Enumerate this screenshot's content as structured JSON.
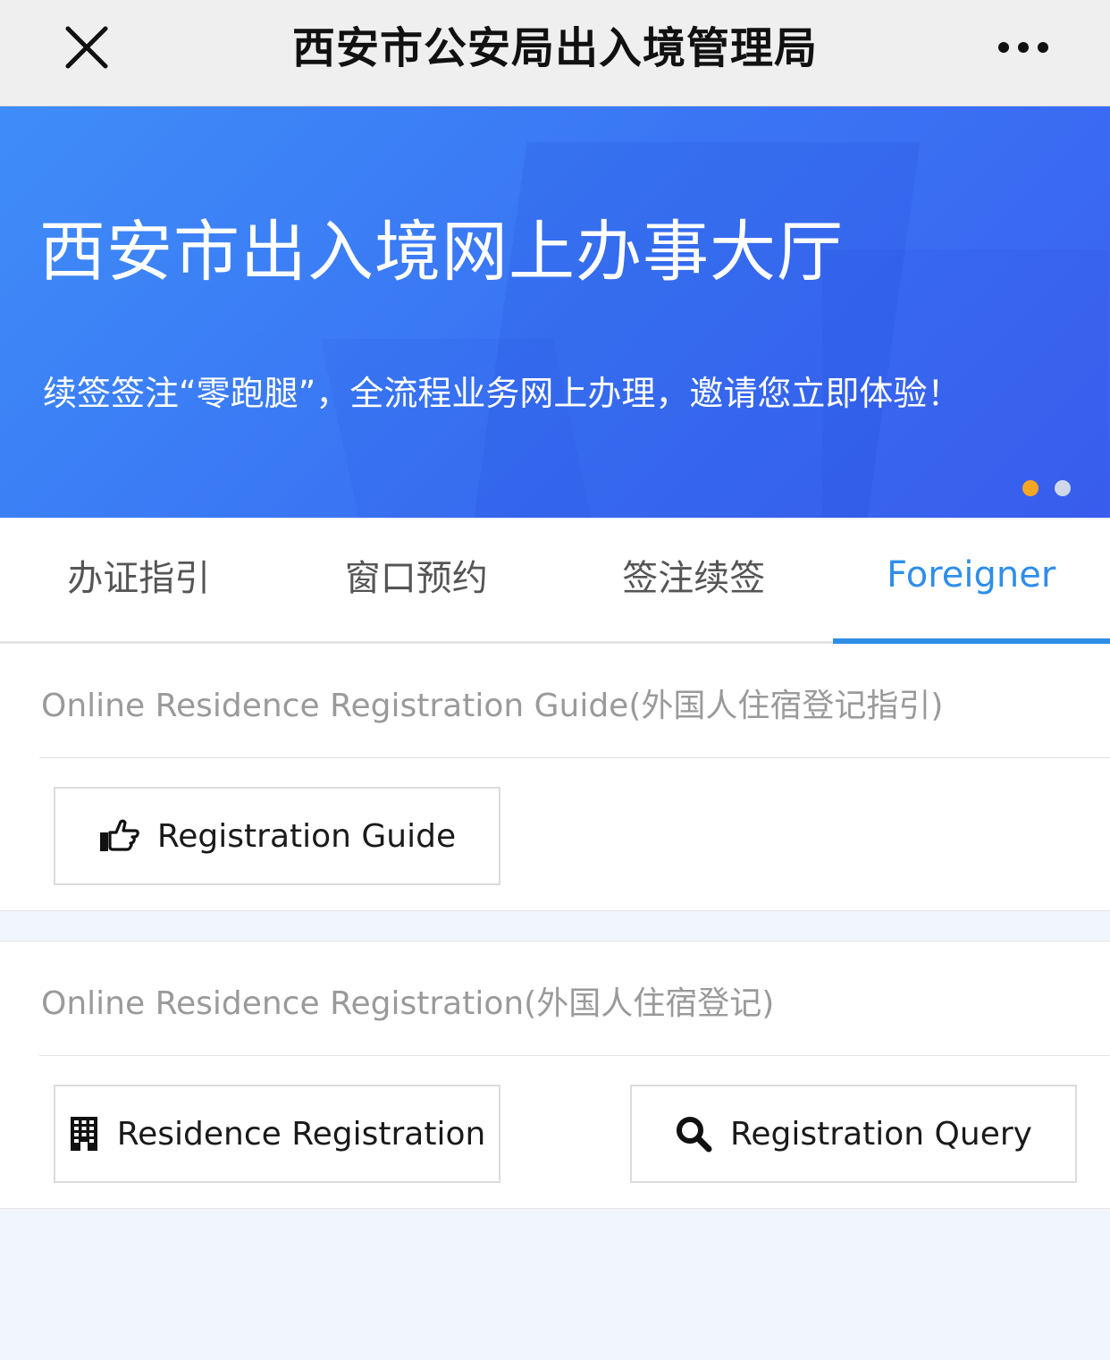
{
  "navbar": {
    "title": "西安市公安局出入境管理局",
    "close_icon": "close-icon",
    "more_icon": "more-dots-icon"
  },
  "banner": {
    "title": "西安市出入境网上办事大厅",
    "subtitle": "续签签注“零跑腿”，全流程业务网上办理，邀请您立即体验！",
    "slide_count": 2,
    "active_slide": 1,
    "colors": {
      "gradient_start": "#3f8df8",
      "gradient_end": "#3b5ff0",
      "active_dot": "#f5a623",
      "inactive_dot": "#cfd8e8"
    }
  },
  "tabs": [
    {
      "label": "办证指引",
      "active": false
    },
    {
      "label": "窗口预约",
      "active": false
    },
    {
      "label": "签注续签",
      "active": false
    },
    {
      "label": "Foreigner",
      "active": true
    }
  ],
  "accent_color": "#2f8ee8",
  "sections": [
    {
      "heading": "Online Residence Registration Guide(外国人住宿登记指引)",
      "buttons": [
        {
          "label": "Registration Guide",
          "icon": "thumbs-pointing-right-icon"
        }
      ]
    },
    {
      "heading": "Online Residence Registration(外国人住宿登记)",
      "buttons": [
        {
          "label": "Residence Registration",
          "icon": "building-icon"
        },
        {
          "label": "Registration Query",
          "icon": "search-icon"
        }
      ]
    }
  ]
}
